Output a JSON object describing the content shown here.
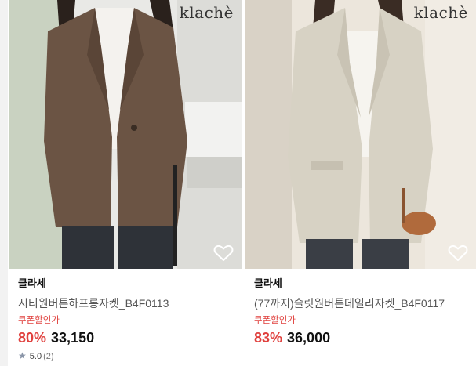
{
  "products": [
    {
      "watermark": "klachè",
      "brand": "클라세",
      "title": "시티원버튼하프롱자켓_B4F0113",
      "coupon_label": "쿠폰할인가",
      "discount": "80%",
      "price": "33,150",
      "rating": "5.0",
      "review_count": "(2)",
      "jacket_color": "#6b5444",
      "bg_color": "#e9e9e6"
    },
    {
      "watermark": "klachè",
      "brand": "클라세",
      "title": "(77까지)슬릿원버튼데일리자켓_B4F0117",
      "coupon_label": "쿠폰할인가",
      "discount": "83%",
      "price": "36,000",
      "jacket_color": "#d7d2c4",
      "bg_color": "#ece6dc"
    }
  ],
  "icons": {
    "wishlist": "heart-outline-icon",
    "rating": "star-icon"
  }
}
